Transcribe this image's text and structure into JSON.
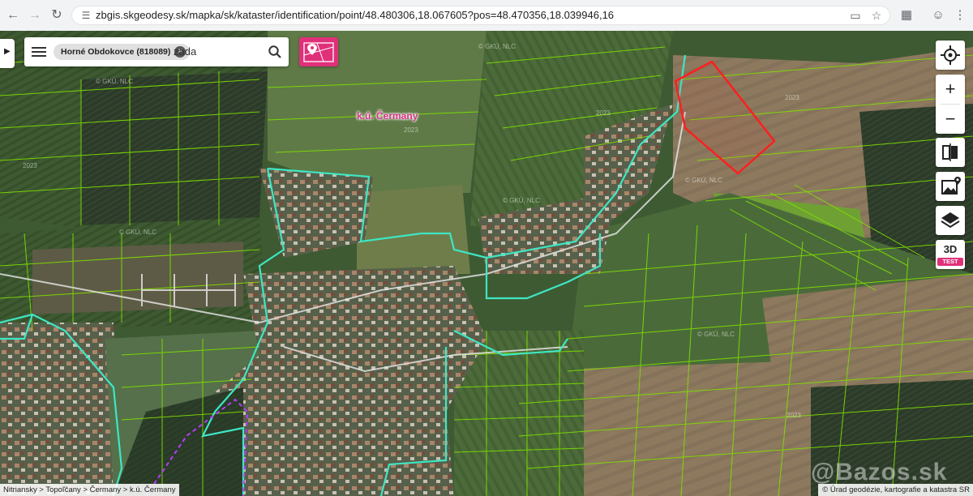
{
  "browser": {
    "url": "zbgis.skgeodesy.sk/mapka/sk/kataster/identification/point/48.480306,18.067605?pos=48.470356,18.039946,16"
  },
  "search": {
    "chip_label": "Horné Obdokovce (818089)",
    "query": "zada"
  },
  "map": {
    "cadastre_label": "k.ú. Čermany",
    "watermarks": [
      "© GKÚ, NLC",
      "2023"
    ],
    "colors": {
      "parcel_lines": "#7fe000",
      "intravilan_boundary": "#3ee6c4",
      "selected_parcel": "#ff1f1f",
      "forest_boundary": "#b43cff"
    }
  },
  "controls": {
    "zoom_in": "+",
    "zoom_out": "−",
    "three_d": "3D",
    "three_d_badge": "TEST",
    "icons": [
      "locate-icon",
      "compare-icon",
      "photo-icon",
      "layers-icon"
    ]
  },
  "footer": {
    "breadcrumb": "Nitriansky > Topoľčany > Čermany > k.ú. Čermany",
    "attribution": "© Úrad geodézie, kartografie a katastra SR",
    "watermark": "@Bazos.sk"
  }
}
